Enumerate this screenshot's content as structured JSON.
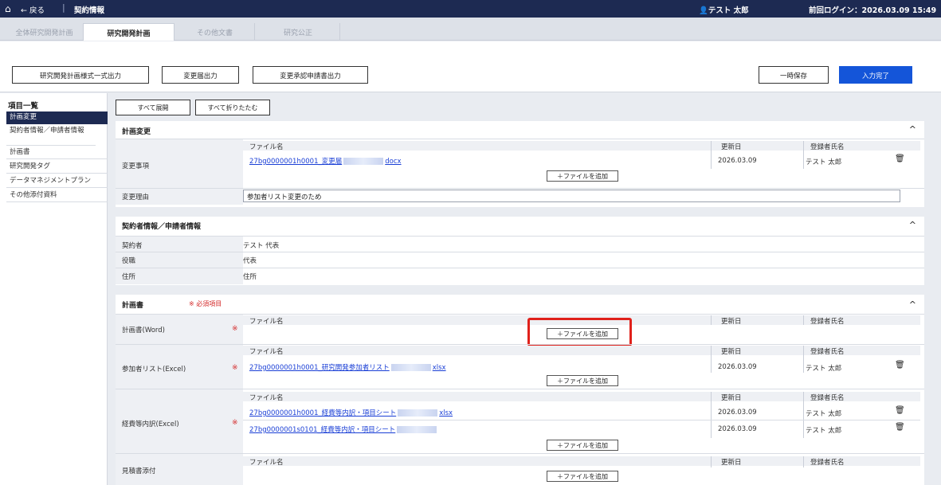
{
  "topbar": {
    "home_icon": "⌂",
    "back": "← 戻る",
    "sep": "|",
    "title": "契約情報",
    "user": "👤テスト 太郎",
    "last_login": "前回ログイン：2026.03.09 15:49"
  },
  "tabs": [
    {
      "label": "全体研究開発計画",
      "active": false
    },
    {
      "label": "研究開発計画",
      "active": true
    },
    {
      "label": "その他文書",
      "active": false
    },
    {
      "label": "研究公正",
      "active": false
    }
  ],
  "actions": {
    "output_plan": "研究開発計画様式一式出力",
    "output_change": "変更届出力",
    "output_approval": "変更承認申請書出力",
    "temp_save": "一時保存",
    "complete": "入力完了"
  },
  "sidebar": {
    "heading": "項目一覧",
    "items": [
      "計画変更",
      "契約者情報／申請者情報",
      "計画書",
      "研究開発タグ",
      "データマネジメントプラン",
      "その他添付資料"
    ]
  },
  "expand": {
    "expand_all": "すべて展開",
    "collapse_all": "すべて折りたたむ"
  },
  "common": {
    "col_filename": "ファイル名",
    "col_updated": "更新日",
    "col_registrant": "登録者氏名",
    "add_file": "＋ファイルを追加",
    "chevron": "^",
    "trash": "🗑",
    "required_star": "※"
  },
  "plan_change": {
    "title": "計画変更",
    "change_item_label": "変更事項",
    "file1_pre": "27bg0000001h0001_変更届",
    "file1_post": "docx",
    "file1_date": "2026.03.09",
    "file1_user": "テスト 太郎",
    "reason_label": "変更理由",
    "reason_value": "参加者リスト変更のため"
  },
  "contractor": {
    "title": "契約者情報／申請者情報",
    "rows": [
      {
        "label": "契約者",
        "value": "テスト 代表"
      },
      {
        "label": "役職",
        "value": "代表"
      },
      {
        "label": "住所",
        "value": "住所"
      }
    ]
  },
  "plan_doc": {
    "title": "計画書",
    "required_note": "※ 必須項目",
    "word_label": "計画書(Word)",
    "participants_label": "参加者リスト(Excel)",
    "participants_file_pre": "27bg0000001h0001_研究開発参加者リスト",
    "participants_file_post": "xlsx",
    "participants_date": "2026.03.09",
    "participants_user": "テスト 太郎",
    "budget_label": "経費等内訳(Excel)",
    "budget_file1_pre": "27bg0000001h0001_経費等内訳・項目シート",
    "budget_file1_post": "xlsx",
    "budget_file1_date": "2026.03.09",
    "budget_file1_user": "テスト 太郎",
    "budget_file2_pre": "27bg0000001s0101_経費等内訳・項目シート",
    "budget_file2_date": "2026.03.09",
    "budget_file2_user": "テスト 太郎",
    "estimate_label": "見積書添付"
  },
  "colors": {
    "topbar": "#1d2a52",
    "primary": "#1455d9",
    "highlight": "#e0211b",
    "link": "#1a3fd6"
  }
}
